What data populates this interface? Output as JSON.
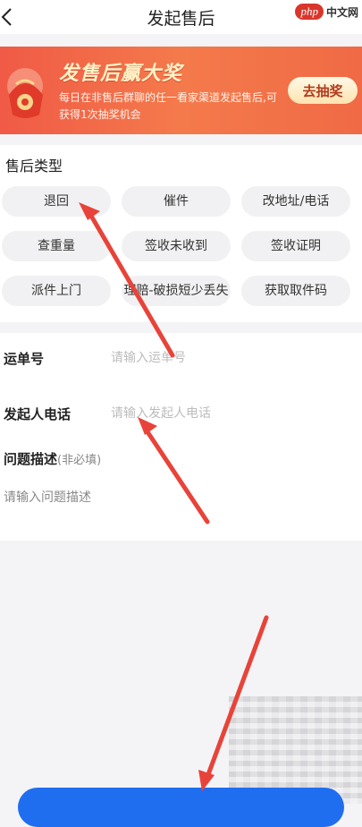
{
  "header": {
    "title": "发起售后",
    "back_icon": "chevron-left-icon"
  },
  "watermark": {
    "badge": "php",
    "text": "中文网"
  },
  "banner": {
    "title": "发售后赢大奖",
    "description": "每日在非售后群聊的任一看家渠道发起售后,可获得1次抽奖机会",
    "button_label": "去抽奖",
    "decoration_icon": "lucky-bag-icon"
  },
  "aftersale_types": {
    "label": "售后类型",
    "options": [
      "退回",
      "催件",
      "改地址/电话",
      "查重量",
      "签收未收到",
      "签收证明",
      "派件上门",
      "理赔-破损短少丢失",
      "获取取件码"
    ]
  },
  "form": {
    "waybill": {
      "label": "运单号",
      "placeholder": "请输入运单号"
    },
    "phone": {
      "label": "发起人电话",
      "placeholder": "请输入发起人电话"
    },
    "description": {
      "label": "问题描述",
      "optional": "(非必填)",
      "placeholder": "请输入问题描述"
    }
  },
  "annotations": {
    "arrow_color": "#e8433a"
  },
  "colors": {
    "banner": "#f05a46",
    "primary": "#1f6ef0"
  }
}
